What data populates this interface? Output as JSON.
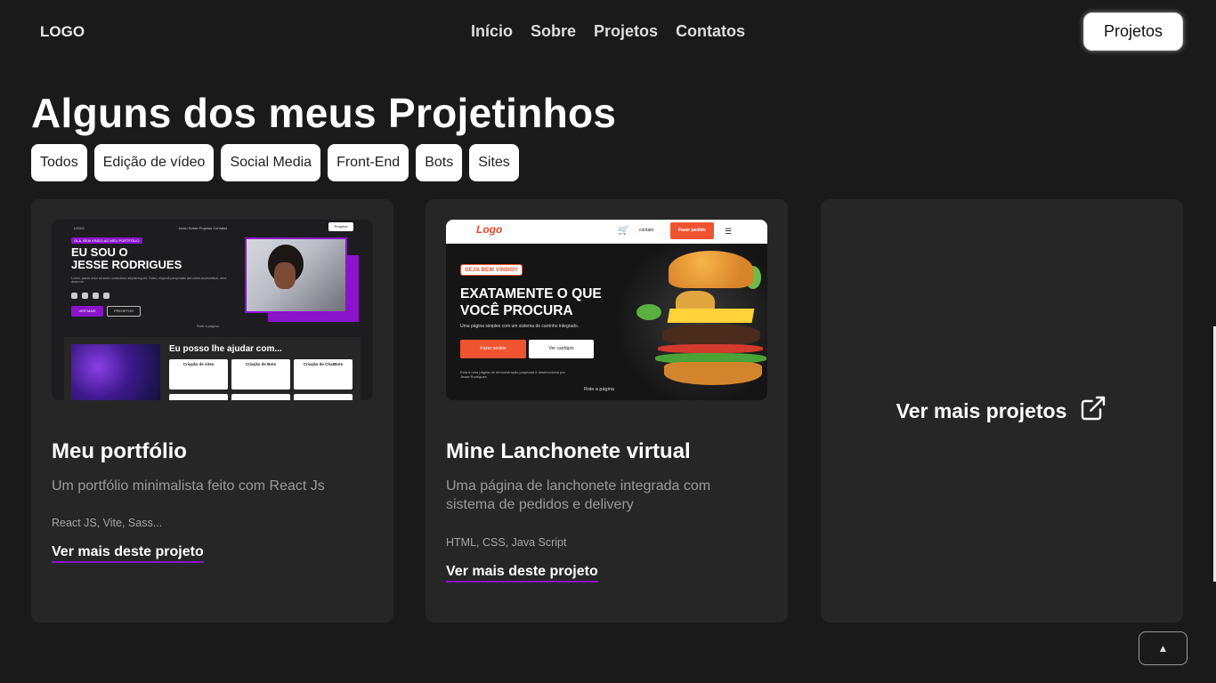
{
  "header": {
    "logo": "LOGO",
    "nav": [
      "Início",
      "Sobre",
      "Projetos",
      "Contatos"
    ],
    "cta_label": "Projetos"
  },
  "page": {
    "title": "Alguns dos meus Projetinhos",
    "filters": [
      "Todos",
      "Edição de vídeo",
      "Social Media",
      "Front-End",
      "Bots",
      "Sites"
    ]
  },
  "projects": [
    {
      "title": "Meu portfólio",
      "description": "Um portfólio minimalista feito com React Js",
      "tech": "React JS, Vite, Sass...",
      "link": "Ver mais deste projeto",
      "thumb": {
        "logo": "LOGO",
        "nav": "Início  Sobre  Projetos  Contatos",
        "button": "Projetos",
        "badge": "OLÁ, BEM VINDO AO MEU PORTFÓLIO",
        "headline_1": "EU SOU O",
        "headline_2": "JESSE RODRIGUES",
        "intro": "Lorem, ipsum dolor sit amet consectetur adipisicing elit. Totam, eligendi perspiciatis sint ullam accusantium, error deserunt.",
        "btn_primary": "VER MAIS",
        "btn_secondary": "PROJETOS",
        "scroll": "Role a página",
        "help_title": "Eu posso lhe ajudar com...",
        "services": [
          "Criação de sites",
          "Criação de Bots",
          "Criação de ChatBots"
        ]
      }
    },
    {
      "title": "Mine Lanchonete virtual",
      "description": "Uma página de lanchonete integrada com sistema de pedidos e delivery",
      "tech": "HTML, CSS, Java Script",
      "link": "Ver mais deste projeto",
      "thumb": {
        "logo": "Logo",
        "contact": "contato",
        "order_btn": "Fazer pedido",
        "badge": "SEJA BEM VINDO!!",
        "headline_1": "EXATAMENTE O QUE",
        "headline_2": "VOCÊ PROCURA",
        "subtitle": "Uma página simples com um sistema de carrinho integrado.",
        "btn_primary": "Fazer pedido",
        "btn_secondary": "Ver cardápio",
        "note": "Esta é uma página de demonstração projetada e desenvolvida por Jesse Rodrigues",
        "scroll": "Role a página"
      }
    }
  ],
  "more_projects": {
    "label": "Ver mais projetos",
    "icon": "external-link-icon"
  },
  "scroll_top": {
    "icon": "caret-up-icon",
    "glyph": "▲"
  },
  "colors": {
    "background": "#1b1a1b",
    "card": "#262627",
    "accent": "#8a14c9",
    "link_underline": "#8a14c9"
  }
}
